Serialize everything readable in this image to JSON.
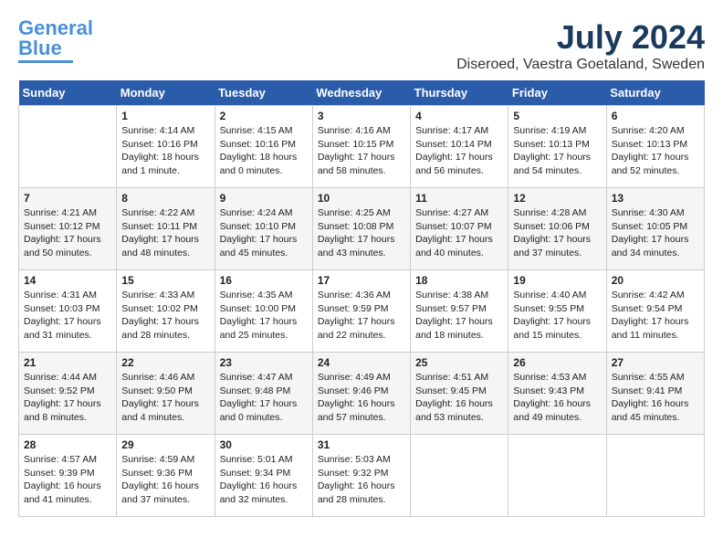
{
  "logo": {
    "line1": "General",
    "line2": "Blue"
  },
  "title": "July 2024",
  "location": "Diseroed, Vaestra Goetaland, Sweden",
  "weekdays": [
    "Sunday",
    "Monday",
    "Tuesday",
    "Wednesday",
    "Thursday",
    "Friday",
    "Saturday"
  ],
  "weeks": [
    [
      {
        "day": "",
        "content": ""
      },
      {
        "day": "1",
        "content": "Sunrise: 4:14 AM\nSunset: 10:16 PM\nDaylight: 18 hours\nand 1 minute."
      },
      {
        "day": "2",
        "content": "Sunrise: 4:15 AM\nSunset: 10:16 PM\nDaylight: 18 hours\nand 0 minutes."
      },
      {
        "day": "3",
        "content": "Sunrise: 4:16 AM\nSunset: 10:15 PM\nDaylight: 17 hours\nand 58 minutes."
      },
      {
        "day": "4",
        "content": "Sunrise: 4:17 AM\nSunset: 10:14 PM\nDaylight: 17 hours\nand 56 minutes."
      },
      {
        "day": "5",
        "content": "Sunrise: 4:19 AM\nSunset: 10:13 PM\nDaylight: 17 hours\nand 54 minutes."
      },
      {
        "day": "6",
        "content": "Sunrise: 4:20 AM\nSunset: 10:13 PM\nDaylight: 17 hours\nand 52 minutes."
      }
    ],
    [
      {
        "day": "7",
        "content": "Sunrise: 4:21 AM\nSunset: 10:12 PM\nDaylight: 17 hours\nand 50 minutes."
      },
      {
        "day": "8",
        "content": "Sunrise: 4:22 AM\nSunset: 10:11 PM\nDaylight: 17 hours\nand 48 minutes."
      },
      {
        "day": "9",
        "content": "Sunrise: 4:24 AM\nSunset: 10:10 PM\nDaylight: 17 hours\nand 45 minutes."
      },
      {
        "day": "10",
        "content": "Sunrise: 4:25 AM\nSunset: 10:08 PM\nDaylight: 17 hours\nand 43 minutes."
      },
      {
        "day": "11",
        "content": "Sunrise: 4:27 AM\nSunset: 10:07 PM\nDaylight: 17 hours\nand 40 minutes."
      },
      {
        "day": "12",
        "content": "Sunrise: 4:28 AM\nSunset: 10:06 PM\nDaylight: 17 hours\nand 37 minutes."
      },
      {
        "day": "13",
        "content": "Sunrise: 4:30 AM\nSunset: 10:05 PM\nDaylight: 17 hours\nand 34 minutes."
      }
    ],
    [
      {
        "day": "14",
        "content": "Sunrise: 4:31 AM\nSunset: 10:03 PM\nDaylight: 17 hours\nand 31 minutes."
      },
      {
        "day": "15",
        "content": "Sunrise: 4:33 AM\nSunset: 10:02 PM\nDaylight: 17 hours\nand 28 minutes."
      },
      {
        "day": "16",
        "content": "Sunrise: 4:35 AM\nSunset: 10:00 PM\nDaylight: 17 hours\nand 25 minutes."
      },
      {
        "day": "17",
        "content": "Sunrise: 4:36 AM\nSunset: 9:59 PM\nDaylight: 17 hours\nand 22 minutes."
      },
      {
        "day": "18",
        "content": "Sunrise: 4:38 AM\nSunset: 9:57 PM\nDaylight: 17 hours\nand 18 minutes."
      },
      {
        "day": "19",
        "content": "Sunrise: 4:40 AM\nSunset: 9:55 PM\nDaylight: 17 hours\nand 15 minutes."
      },
      {
        "day": "20",
        "content": "Sunrise: 4:42 AM\nSunset: 9:54 PM\nDaylight: 17 hours\nand 11 minutes."
      }
    ],
    [
      {
        "day": "21",
        "content": "Sunrise: 4:44 AM\nSunset: 9:52 PM\nDaylight: 17 hours\nand 8 minutes."
      },
      {
        "day": "22",
        "content": "Sunrise: 4:46 AM\nSunset: 9:50 PM\nDaylight: 17 hours\nand 4 minutes."
      },
      {
        "day": "23",
        "content": "Sunrise: 4:47 AM\nSunset: 9:48 PM\nDaylight: 17 hours\nand 0 minutes."
      },
      {
        "day": "24",
        "content": "Sunrise: 4:49 AM\nSunset: 9:46 PM\nDaylight: 16 hours\nand 57 minutes."
      },
      {
        "day": "25",
        "content": "Sunrise: 4:51 AM\nSunset: 9:45 PM\nDaylight: 16 hours\nand 53 minutes."
      },
      {
        "day": "26",
        "content": "Sunrise: 4:53 AM\nSunset: 9:43 PM\nDaylight: 16 hours\nand 49 minutes."
      },
      {
        "day": "27",
        "content": "Sunrise: 4:55 AM\nSunset: 9:41 PM\nDaylight: 16 hours\nand 45 minutes."
      }
    ],
    [
      {
        "day": "28",
        "content": "Sunrise: 4:57 AM\nSunset: 9:39 PM\nDaylight: 16 hours\nand 41 minutes."
      },
      {
        "day": "29",
        "content": "Sunrise: 4:59 AM\nSunset: 9:36 PM\nDaylight: 16 hours\nand 37 minutes."
      },
      {
        "day": "30",
        "content": "Sunrise: 5:01 AM\nSunset: 9:34 PM\nDaylight: 16 hours\nand 32 minutes."
      },
      {
        "day": "31",
        "content": "Sunrise: 5:03 AM\nSunset: 9:32 PM\nDaylight: 16 hours\nand 28 minutes."
      },
      {
        "day": "",
        "content": ""
      },
      {
        "day": "",
        "content": ""
      },
      {
        "day": "",
        "content": ""
      }
    ]
  ]
}
